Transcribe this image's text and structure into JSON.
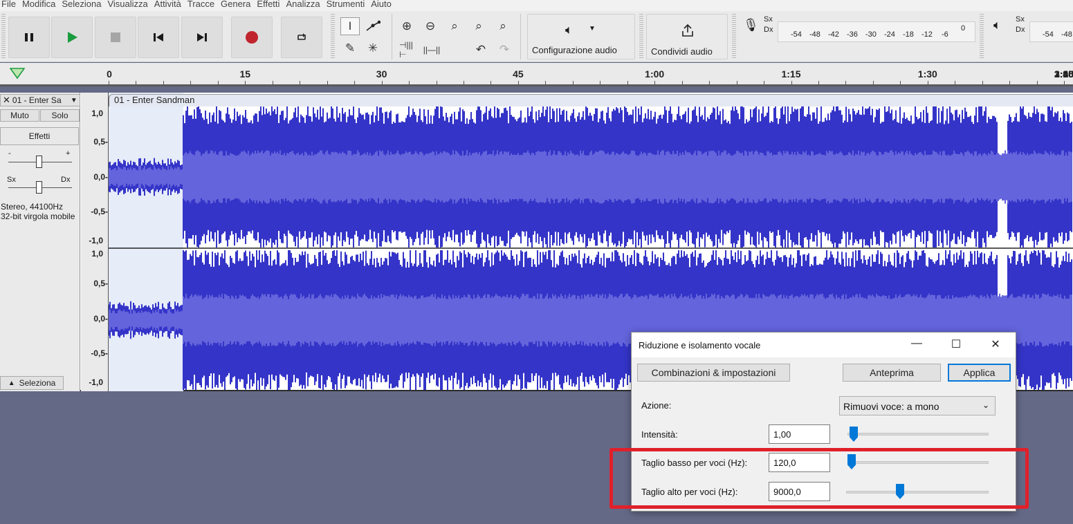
{
  "menu": [
    "File",
    "Modifica",
    "Seleziona",
    "Visualizza",
    "Attività",
    "Tracce",
    "Genera",
    "Effetti",
    "Analizza",
    "Strumenti",
    "Aiuto"
  ],
  "toolbar": {
    "audio_setup_label": "Configurazione audio",
    "share_audio_label": "Condividi audio",
    "rec_meter_channels": [
      "Sx",
      "Dx"
    ],
    "play_meter_channels": [
      "Sx",
      "Dx"
    ],
    "meter_scale": [
      "-54",
      "-48",
      "-42",
      "-36",
      "-30",
      "-24",
      "-18",
      "-12",
      "-6",
      "0"
    ],
    "play_meter_scale": [
      "-54",
      "-48"
    ],
    "record_color": "#c0252e",
    "play_color": "#1a9c3e"
  },
  "timeline": {
    "labels": [
      "0",
      "15",
      "30",
      "45",
      "1:00",
      "1:15",
      "1:30",
      "1:45",
      "2:00",
      "2:15",
      "2:30",
      "2:45",
      "3:00",
      "3:15",
      "3:30"
    ]
  },
  "track": {
    "name": "01 - Enter Sa",
    "clip_title": "01 - Enter Sandman",
    "mute_label": "Muto",
    "solo_label": "Solo",
    "effects_label": "Effetti",
    "gain_minus": "-",
    "gain_plus": "+",
    "pan_left": "Sx",
    "pan_right": "Dx",
    "format_line1": "Stereo, 44100Hz",
    "format_line2": "32-bit virgola mobile",
    "select_label": "Seleziona",
    "scale_labels": [
      "1,0",
      "0,5-",
      "0,0-",
      "-0,5-",
      "-1,0"
    ],
    "wave_color": "#3434c8",
    "rms_color": "#6464dc"
  },
  "dialog": {
    "title": "Riduzione e isolamento vocale",
    "presets_button": "Combinazioni & impostazioni",
    "preview_button": "Anteprima",
    "apply_button": "Applica",
    "action_label": "Azione:",
    "action_value": "Rimuovi voce: a mono",
    "strength_label": "Intensità:",
    "strength_value": "1,00",
    "low_cut_label": "Taglio basso per voci (Hz):",
    "low_cut_value": "120,0",
    "high_cut_label": "Taglio alto per voci (Hz):",
    "high_cut_value": "9000,0",
    "highlight_color": "#e0202a"
  }
}
